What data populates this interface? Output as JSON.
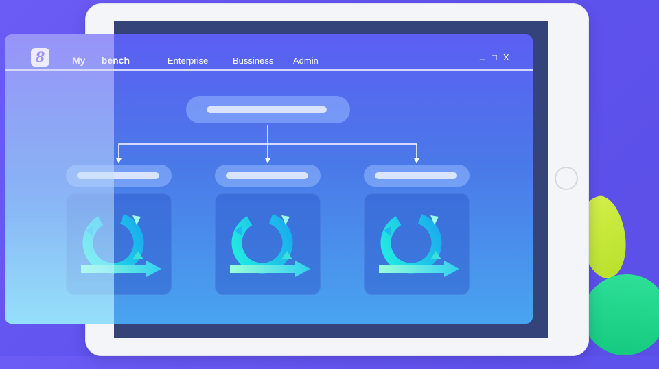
{
  "window": {
    "logo_text": "8",
    "title": "My      bench",
    "nav": [
      "Enterprise",
      "Bussiness",
      "Admin"
    ],
    "controls": {
      "minimize": "_",
      "maximize": "□",
      "close": "X"
    }
  },
  "diagram": {
    "root_label": "",
    "children": [
      "",
      "",
      ""
    ],
    "card_icon": "cycle-arrow-icon"
  },
  "colors": {
    "background": "#6b5cf5",
    "window_top": "#5b5ff3",
    "window_bottom": "#49a4f0",
    "screen_bezel": "#34447a",
    "accent_cyan": "#21e8d6",
    "leaf_yellow": "#c6e83a",
    "leaf_green": "#1fd38a"
  }
}
